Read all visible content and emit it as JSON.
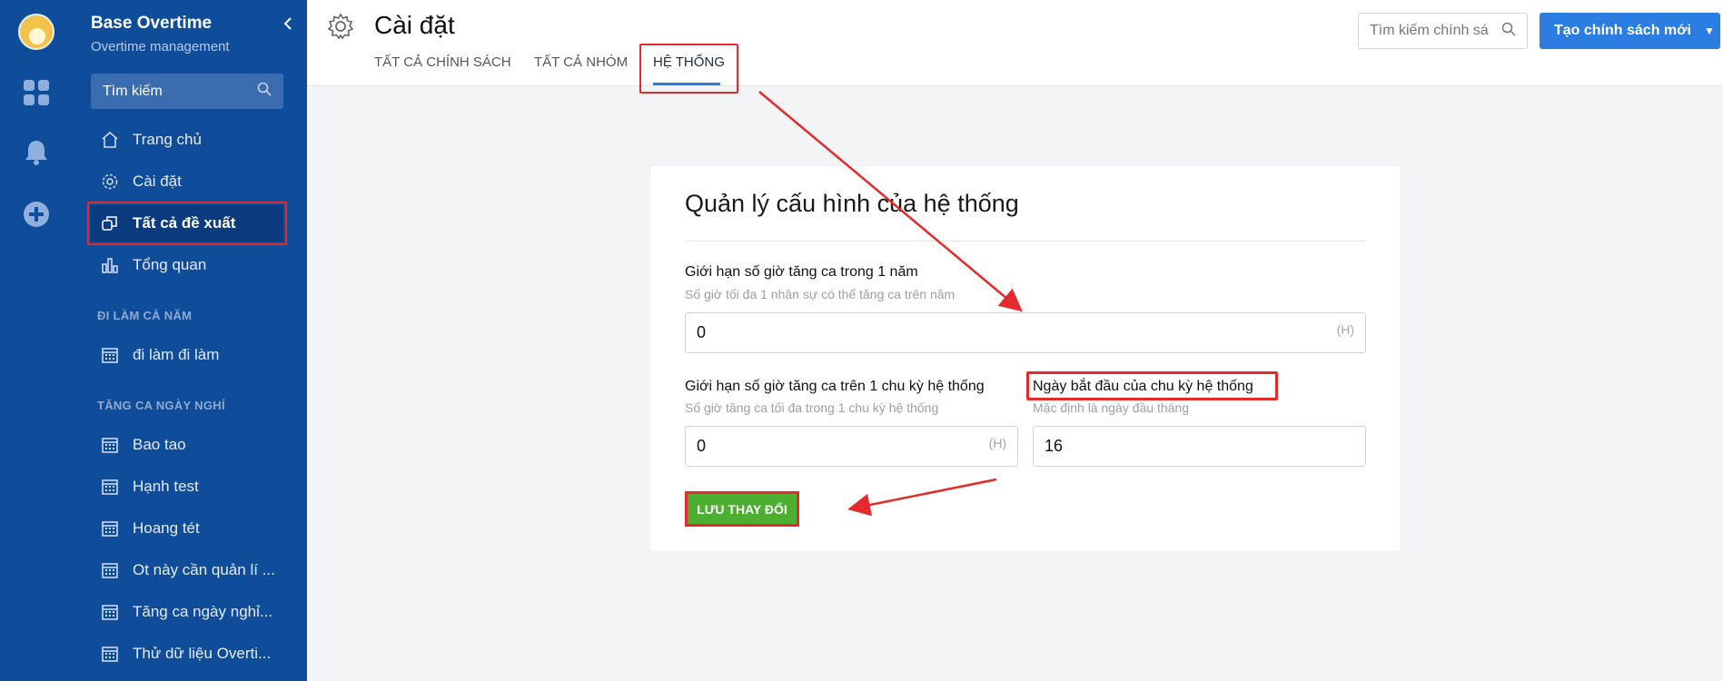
{
  "app": {
    "title": "Base Overtime",
    "subtitle": "Overtime management",
    "search_placeholder": "Tìm kiếm"
  },
  "sidebar": {
    "items": [
      {
        "label": "Trang chủ",
        "icon": "home-icon"
      },
      {
        "label": "Cài đặt",
        "icon": "gear-icon"
      },
      {
        "label": "Tất cả đề xuất",
        "icon": "copy-icon"
      },
      {
        "label": "Tổng quan",
        "icon": "bar-chart-icon"
      }
    ],
    "section1": {
      "title": "ĐI LÀM CẢ NĂM",
      "items": [
        {
          "label": "đi làm đi làm"
        }
      ]
    },
    "section2": {
      "title": "TĂNG CA NGÀY NGHỈ",
      "items": [
        {
          "label": "Bao tao"
        },
        {
          "label": "Hạnh test"
        },
        {
          "label": "Hoang tét"
        },
        {
          "label": "Ot này cần quản lí ..."
        },
        {
          "label": "Tăng ca ngày nghỉ..."
        },
        {
          "label": "Thử dữ liệu Overti..."
        }
      ]
    }
  },
  "header": {
    "title": "Cài đặt",
    "tabs": [
      {
        "label": "TẤT CẢ CHÍNH SÁCH"
      },
      {
        "label": "TẤT CẢ NHÓM"
      },
      {
        "label": "HỆ THỐNG"
      }
    ],
    "search_placeholder": "Tìm kiếm chính sá",
    "create_button": "Tạo chính sách mới"
  },
  "card": {
    "title": "Quản lý cấu hình của hệ thống",
    "field1": {
      "label": "Giới hạn số giờ tăng ca trong 1 năm",
      "hint": "Số giờ tối đa 1 nhân sự có thể tăng ca trên năm",
      "value": "0",
      "unit": "(H)"
    },
    "field2": {
      "label": "Giới hạn số giờ tăng ca trên 1 chu kỳ hệ thống",
      "hint": "Số giờ tăng ca tối đa trong 1 chu kỳ hệ thống",
      "value": "0",
      "unit": "(H)"
    },
    "field3": {
      "label": "Ngày bắt đầu của chu kỳ hệ thống",
      "hint": "Mặc định là ngày đầu tháng",
      "value": "16"
    },
    "save_button": "LƯU THAY ĐỔI"
  },
  "colors": {
    "sidebar": "#0f4c9a",
    "primary": "#2b7de1",
    "save": "#4caf32",
    "annotation": "#e42a2a"
  }
}
